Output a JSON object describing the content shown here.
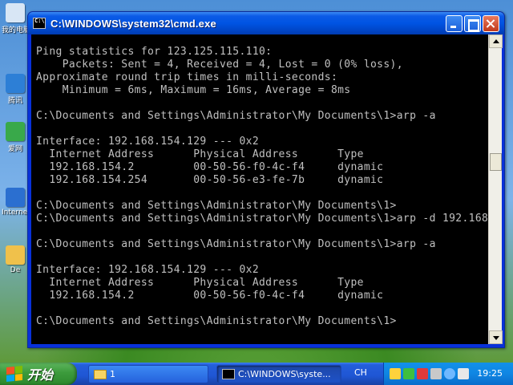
{
  "desktop": {
    "icons": [
      {
        "label": "我的电脑",
        "color": "#d8e6f5"
      },
      {
        "label": "腾讯",
        "color": "#2d7fd6"
      },
      {
        "label": "爱网",
        "color": "#39a94a"
      },
      {
        "label": "Internet Explorer",
        "color": "#2b6fd0"
      },
      {
        "label": "De",
        "color": "#f0c14b"
      }
    ]
  },
  "window": {
    "title": "C:\\WINDOWS\\system32\\cmd.exe",
    "console_lines": [
      "Ping statistics for 123.125.115.110:",
      "    Packets: Sent = 4, Received = 4, Lost = 0 (0% loss),",
      "Approximate round trip times in milli-seconds:",
      "    Minimum = 6ms, Maximum = 16ms, Average = 8ms",
      "",
      "C:\\Documents and Settings\\Administrator\\My Documents\\1>arp -a",
      "",
      "Interface: 192.168.154.129 --- 0x2",
      "  Internet Address      Physical Address      Type",
      "  192.168.154.2         00-50-56-f0-4c-f4     dynamic",
      "  192.168.154.254       00-50-56-e3-fe-7b     dynamic",
      "",
      "C:\\Documents and Settings\\Administrator\\My Documents\\1>",
      "C:\\Documents and Settings\\Administrator\\My Documents\\1>arp -d 192.168.",
      "",
      "C:\\Documents and Settings\\Administrator\\My Documents\\1>arp -a",
      "",
      "Interface: 192.168.154.129 --- 0x2",
      "  Internet Address      Physical Address      Type",
      "  192.168.154.2         00-50-56-f0-4c-f4     dynamic",
      "",
      "C:\\Documents and Settings\\Administrator\\My Documents\\1>"
    ]
  },
  "taskbar": {
    "start_label": "开始",
    "items": [
      {
        "label": "1",
        "icon": "folder-icon"
      },
      {
        "label": "C:\\WINDOWS\\syste...",
        "icon": "cmd-icon"
      }
    ],
    "language": "CH",
    "tray_icons": [
      {
        "name": "shield-icon",
        "color": "#ffd23c"
      },
      {
        "name": "network-icon",
        "color": "#3fbf3f"
      },
      {
        "name": "antivirus-icon",
        "color": "#e03a3a"
      },
      {
        "name": "vmware-icon",
        "color": "#c9c9c9"
      },
      {
        "name": "globe-icon",
        "color": "#6fb8ff"
      },
      {
        "name": "speaker-icon",
        "color": "#e8e8e8"
      }
    ],
    "clock": "19:25"
  }
}
